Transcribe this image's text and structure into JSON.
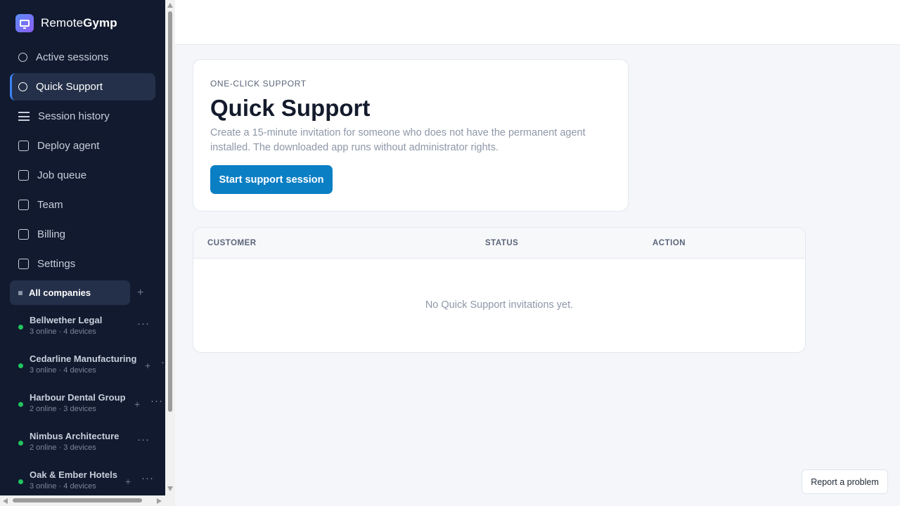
{
  "brand": {
    "name_light": "Remote",
    "name_bold": "Gymp",
    "logo_icon": "monitor-icon"
  },
  "sidebar": {
    "nav": [
      {
        "label": "Active sessions",
        "icon": "circle-icon"
      },
      {
        "label": "Quick Support",
        "icon": "circle-icon",
        "active": true
      },
      {
        "label": "Session history",
        "icon": "list-icon"
      },
      {
        "label": "Deploy agent",
        "icon": "square-icon"
      },
      {
        "label": "Job queue",
        "icon": "square-icon"
      },
      {
        "label": "Team",
        "icon": "square-icon"
      },
      {
        "label": "Billing",
        "icon": "square-icon"
      },
      {
        "label": "Settings",
        "icon": "square-icon"
      }
    ],
    "companies_label": "All companies",
    "companies_add": "+",
    "companies": [
      {
        "name": "Bellwether Legal",
        "meta": "3 online · 4 devices"
      },
      {
        "name": "Cedarline Manufacturing",
        "meta": "3 online · 4 devices"
      },
      {
        "name": "Harbour Dental Group",
        "meta": "2 online · 3 devices"
      },
      {
        "name": "Nimbus Architecture",
        "meta": "2 online · 3 devices"
      },
      {
        "name": "Oak & Ember Hotels",
        "meta": "3 online · 4 devices"
      }
    ],
    "more_glyph": "···",
    "plus_glyph": "+"
  },
  "main": {
    "eyebrow": "ONE-CLICK SUPPORT",
    "title": "Quick Support",
    "description": "Create a 15-minute invitation for someone who does not have the permanent agent installed. The downloaded app runs without administrator rights.",
    "start_button": "Start support session",
    "table": {
      "columns": [
        "CUSTOMER",
        "STATUS",
        "ACTION"
      ],
      "empty_text": "No Quick Support invitations yet."
    }
  },
  "report_button": "Report a problem",
  "colors": {
    "sidebar_bg": "#111a2e",
    "accent": "#0b7fc4",
    "online": "#22c55e"
  }
}
